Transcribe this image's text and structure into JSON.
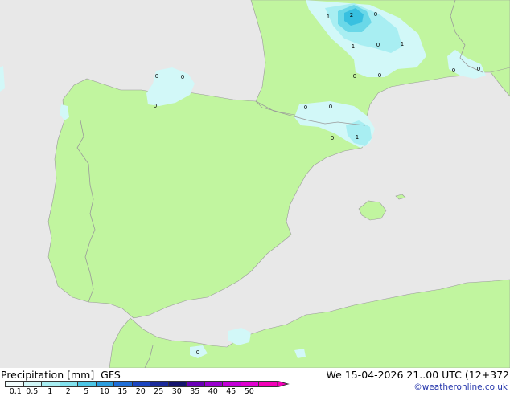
{
  "map": {
    "colors": {
      "sea": "#e8e8e8",
      "land": "#c1f59f",
      "border": "#9a9a9a",
      "precip_light": "#d2f8f8",
      "precip_mid": "#a8eef2",
      "precip_heavy": "#6ad8e8",
      "precip_core": "#38c0e0"
    },
    "value_labels": [
      {
        "id": "fr-1",
        "text": "1"
      },
      {
        "id": "fr-2",
        "text": "2"
      },
      {
        "id": "fr-0a",
        "text": "0"
      },
      {
        "id": "fr-1b",
        "text": "1"
      },
      {
        "id": "fr-0b",
        "text": "0"
      },
      {
        "id": "fr-1c",
        "text": "1"
      },
      {
        "id": "fr-0c",
        "text": "0"
      },
      {
        "id": "fr-0d",
        "text": "0"
      },
      {
        "id": "alps-0",
        "text": "0"
      },
      {
        "id": "alps-0b",
        "text": "0"
      },
      {
        "id": "bay-0a",
        "text": "0"
      },
      {
        "id": "bay-0b",
        "text": "0"
      },
      {
        "id": "cant-0",
        "text": "0"
      },
      {
        "id": "pyr-0a",
        "text": "0"
      },
      {
        "id": "pyr-0b",
        "text": "0"
      },
      {
        "id": "cat-0",
        "text": "0"
      },
      {
        "id": "cat-1",
        "text": "1"
      },
      {
        "id": "mor-0",
        "text": "0"
      }
    ]
  },
  "footer": {
    "title": "Precipitation [mm]  GFS",
    "run_info": "We 15-04-2026 21..00 UTC (12+372",
    "credit": "©weatheronline.co.uk",
    "scale": {
      "colors": [
        "#f2fdfd",
        "#d2f8f8",
        "#a8eef2",
        "#82e2ee",
        "#4cc6e6",
        "#2a9ee0",
        "#1f6fd8",
        "#1b45c0",
        "#1a2a9a",
        "#14146e",
        "#6a00b8",
        "#9a00d0",
        "#c400d8",
        "#e000d0",
        "#f400b8"
      ],
      "labels": [
        "0.1",
        "0.5",
        "1",
        "2",
        "5",
        "10",
        "15",
        "20",
        "25",
        "30",
        "35",
        "40",
        "45",
        "50"
      ]
    }
  }
}
